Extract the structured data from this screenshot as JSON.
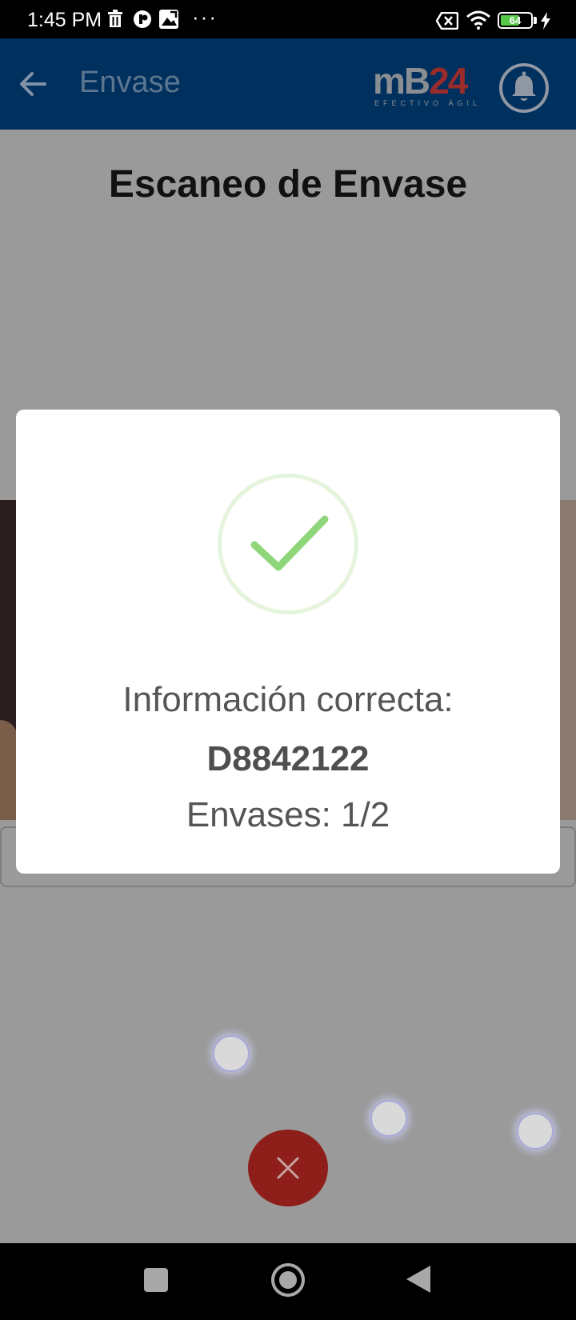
{
  "status_bar": {
    "time": "1:45 PM",
    "more": "···",
    "battery_level": "64",
    "battery_fraction": 0.64,
    "icons": [
      "trash-icon",
      "notification-app-icon",
      "image-icon",
      "sim-off-icon",
      "wifi-icon",
      "battery-icon",
      "charging-icon"
    ]
  },
  "app_bar": {
    "title": "Envase",
    "logo_main_left": "mB",
    "logo_main_right": "24",
    "logo_sub": "EFECTIVO ÁGIL",
    "icons": [
      "back-arrow-icon",
      "bell-icon"
    ]
  },
  "page": {
    "heading": "Escaneo de Envase"
  },
  "dialog": {
    "message": "Información correcta:",
    "code": "D8842122",
    "count": "Envases: 1/2",
    "icon": "checkmark-icon"
  },
  "colors": {
    "app_bar": "#003366",
    "close_fab": "#c62828",
    "success": "#8fd67a",
    "success_ring": "#e5f5dc"
  },
  "nav_bar": {
    "icons": [
      "recents-square-icon",
      "home-circle-icon",
      "back-triangle-icon"
    ]
  }
}
